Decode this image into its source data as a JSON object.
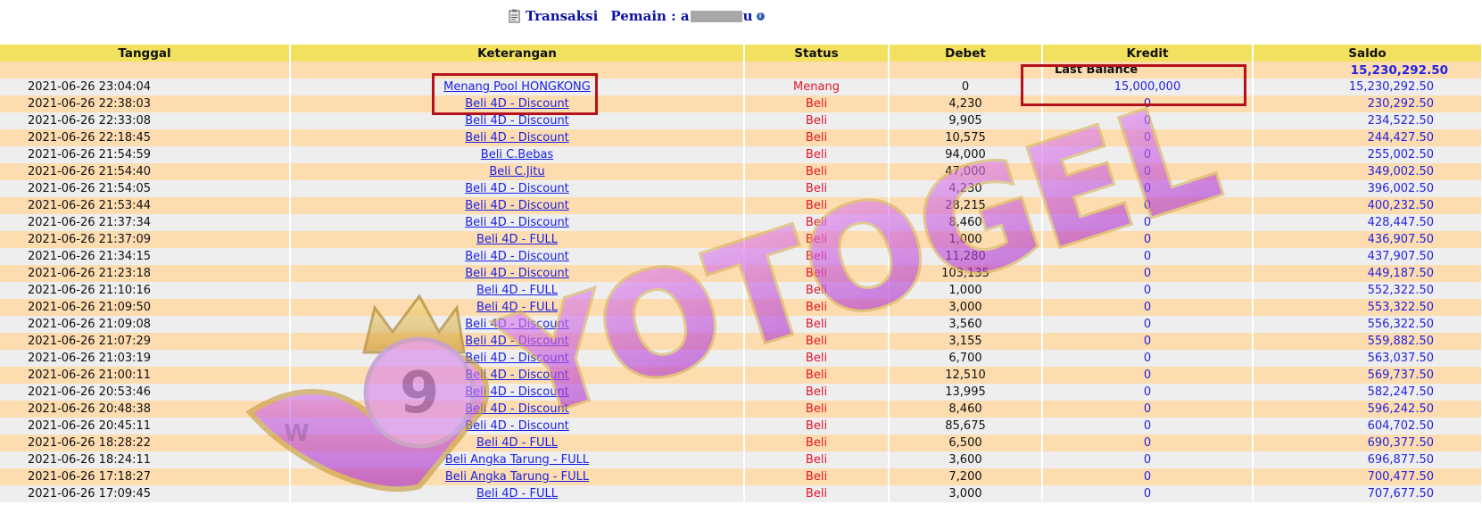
{
  "header": {
    "title_label": "Transaksi",
    "player_label": "Pemain : a",
    "player_suffix": "u"
  },
  "columns": [
    "Tanggal",
    "Keterangan",
    "Status",
    "Debet",
    "Kredit",
    "Saldo"
  ],
  "last_balance": {
    "label": "Last Balance",
    "value": "15,230,292.50"
  },
  "rows": [
    {
      "date": "2021-06-26 23:04:04",
      "desc": "Menang Pool HONGKONG",
      "status": "Menang",
      "debet": "0",
      "kredit": "15,000,000",
      "saldo": "15,230,292.50"
    },
    {
      "date": "2021-06-26 22:38:03",
      "desc": "Beli 4D - Discount",
      "status": "Beli",
      "debet": "4,230",
      "kredit": "0",
      "saldo": "230,292.50"
    },
    {
      "date": "2021-06-26 22:33:08",
      "desc": "Beli 4D - Discount",
      "status": "Beli",
      "debet": "9,905",
      "kredit": "0",
      "saldo": "234,522.50"
    },
    {
      "date": "2021-06-26 22:18:45",
      "desc": "Beli 4D - Discount",
      "status": "Beli",
      "debet": "10,575",
      "kredit": "0",
      "saldo": "244,427.50"
    },
    {
      "date": "2021-06-26 21:54:59",
      "desc": "Beli C.Bebas",
      "status": "Beli",
      "debet": "94,000",
      "kredit": "0",
      "saldo": "255,002.50"
    },
    {
      "date": "2021-06-26 21:54:40",
      "desc": "Beli C.Jitu",
      "status": "Beli",
      "debet": "47,000",
      "kredit": "0",
      "saldo": "349,002.50"
    },
    {
      "date": "2021-06-26 21:54:05",
      "desc": "Beli 4D - Discount",
      "status": "Beli",
      "debet": "4,230",
      "kredit": "0",
      "saldo": "396,002.50"
    },
    {
      "date": "2021-06-26 21:53:44",
      "desc": "Beli 4D - Discount",
      "status": "Beli",
      "debet": "28,215",
      "kredit": "0",
      "saldo": "400,232.50"
    },
    {
      "date": "2021-06-26 21:37:34",
      "desc": "Beli 4D - Discount",
      "status": "Beli",
      "debet": "8,460",
      "kredit": "0",
      "saldo": "428,447.50"
    },
    {
      "date": "2021-06-26 21:37:09",
      "desc": "Beli 4D - FULL",
      "status": "Beli",
      "debet": "1,000",
      "kredit": "0",
      "saldo": "436,907.50"
    },
    {
      "date": "2021-06-26 21:34:15",
      "desc": "Beli 4D - Discount",
      "status": "Beli",
      "debet": "11,280",
      "kredit": "0",
      "saldo": "437,907.50"
    },
    {
      "date": "2021-06-26 21:23:18",
      "desc": "Beli 4D - Discount",
      "status": "Beli",
      "debet": "103,135",
      "kredit": "0",
      "saldo": "449,187.50"
    },
    {
      "date": "2021-06-26 21:10:16",
      "desc": "Beli 4D - FULL",
      "status": "Beli",
      "debet": "1,000",
      "kredit": "0",
      "saldo": "552,322.50"
    },
    {
      "date": "2021-06-26 21:09:50",
      "desc": "Beli 4D - FULL",
      "status": "Beli",
      "debet": "3,000",
      "kredit": "0",
      "saldo": "553,322.50"
    },
    {
      "date": "2021-06-26 21:09:08",
      "desc": "Beli 4D - Discount",
      "status": "Beli",
      "debet": "3,560",
      "kredit": "0",
      "saldo": "556,322.50"
    },
    {
      "date": "2021-06-26 21:07:29",
      "desc": "Beli 4D - Discount",
      "status": "Beli",
      "debet": "3,155",
      "kredit": "0",
      "saldo": "559,882.50"
    },
    {
      "date": "2021-06-26 21:03:19",
      "desc": "Beli 4D - Discount",
      "status": "Beli",
      "debet": "6,700",
      "kredit": "0",
      "saldo": "563,037.50"
    },
    {
      "date": "2021-06-26 21:00:11",
      "desc": "Beli 4D - Discount",
      "status": "Beli",
      "debet": "12,510",
      "kredit": "0",
      "saldo": "569,737.50"
    },
    {
      "date": "2021-06-26 20:53:46",
      "desc": "Beli 4D - Discount",
      "status": "Beli",
      "debet": "13,995",
      "kredit": "0",
      "saldo": "582,247.50"
    },
    {
      "date": "2021-06-26 20:48:38",
      "desc": "Beli 4D - Discount",
      "status": "Beli",
      "debet": "8,460",
      "kredit": "0",
      "saldo": "596,242.50"
    },
    {
      "date": "2021-06-26 20:45:11",
      "desc": "Beli 4D - Discount",
      "status": "Beli",
      "debet": "85,675",
      "kredit": "0",
      "saldo": "604,702.50"
    },
    {
      "date": "2021-06-26 18:28:22",
      "desc": "Beli 4D - FULL",
      "status": "Beli",
      "debet": "6,500",
      "kredit": "0",
      "saldo": "690,377.50"
    },
    {
      "date": "2021-06-26 18:24:11",
      "desc": "Beli Angka Tarung - FULL",
      "status": "Beli",
      "debet": "3,600",
      "kredit": "0",
      "saldo": "696,877.50"
    },
    {
      "date": "2021-06-26 17:18:27",
      "desc": "Beli Angka Tarung - FULL",
      "status": "Beli",
      "debet": "7,200",
      "kredit": "0",
      "saldo": "700,477.50"
    },
    {
      "date": "2021-06-26 17:09:45",
      "desc": "Beli 4D - FULL",
      "status": "Beli",
      "debet": "3,000",
      "kredit": "0",
      "saldo": "707,677.50"
    }
  ],
  "watermark": {
    "text": "YOTOGEL",
    "logo_digit": "9",
    "logo_letter": "W"
  },
  "colors": {
    "header_bg": "#f2e15e",
    "row_odd": "#fddcb0",
    "row_even": "#eeeeee",
    "link": "#1a22e6",
    "status_red": "#e2162a",
    "money_blue": "#2323e0",
    "highlight_box": "#b3121c"
  }
}
